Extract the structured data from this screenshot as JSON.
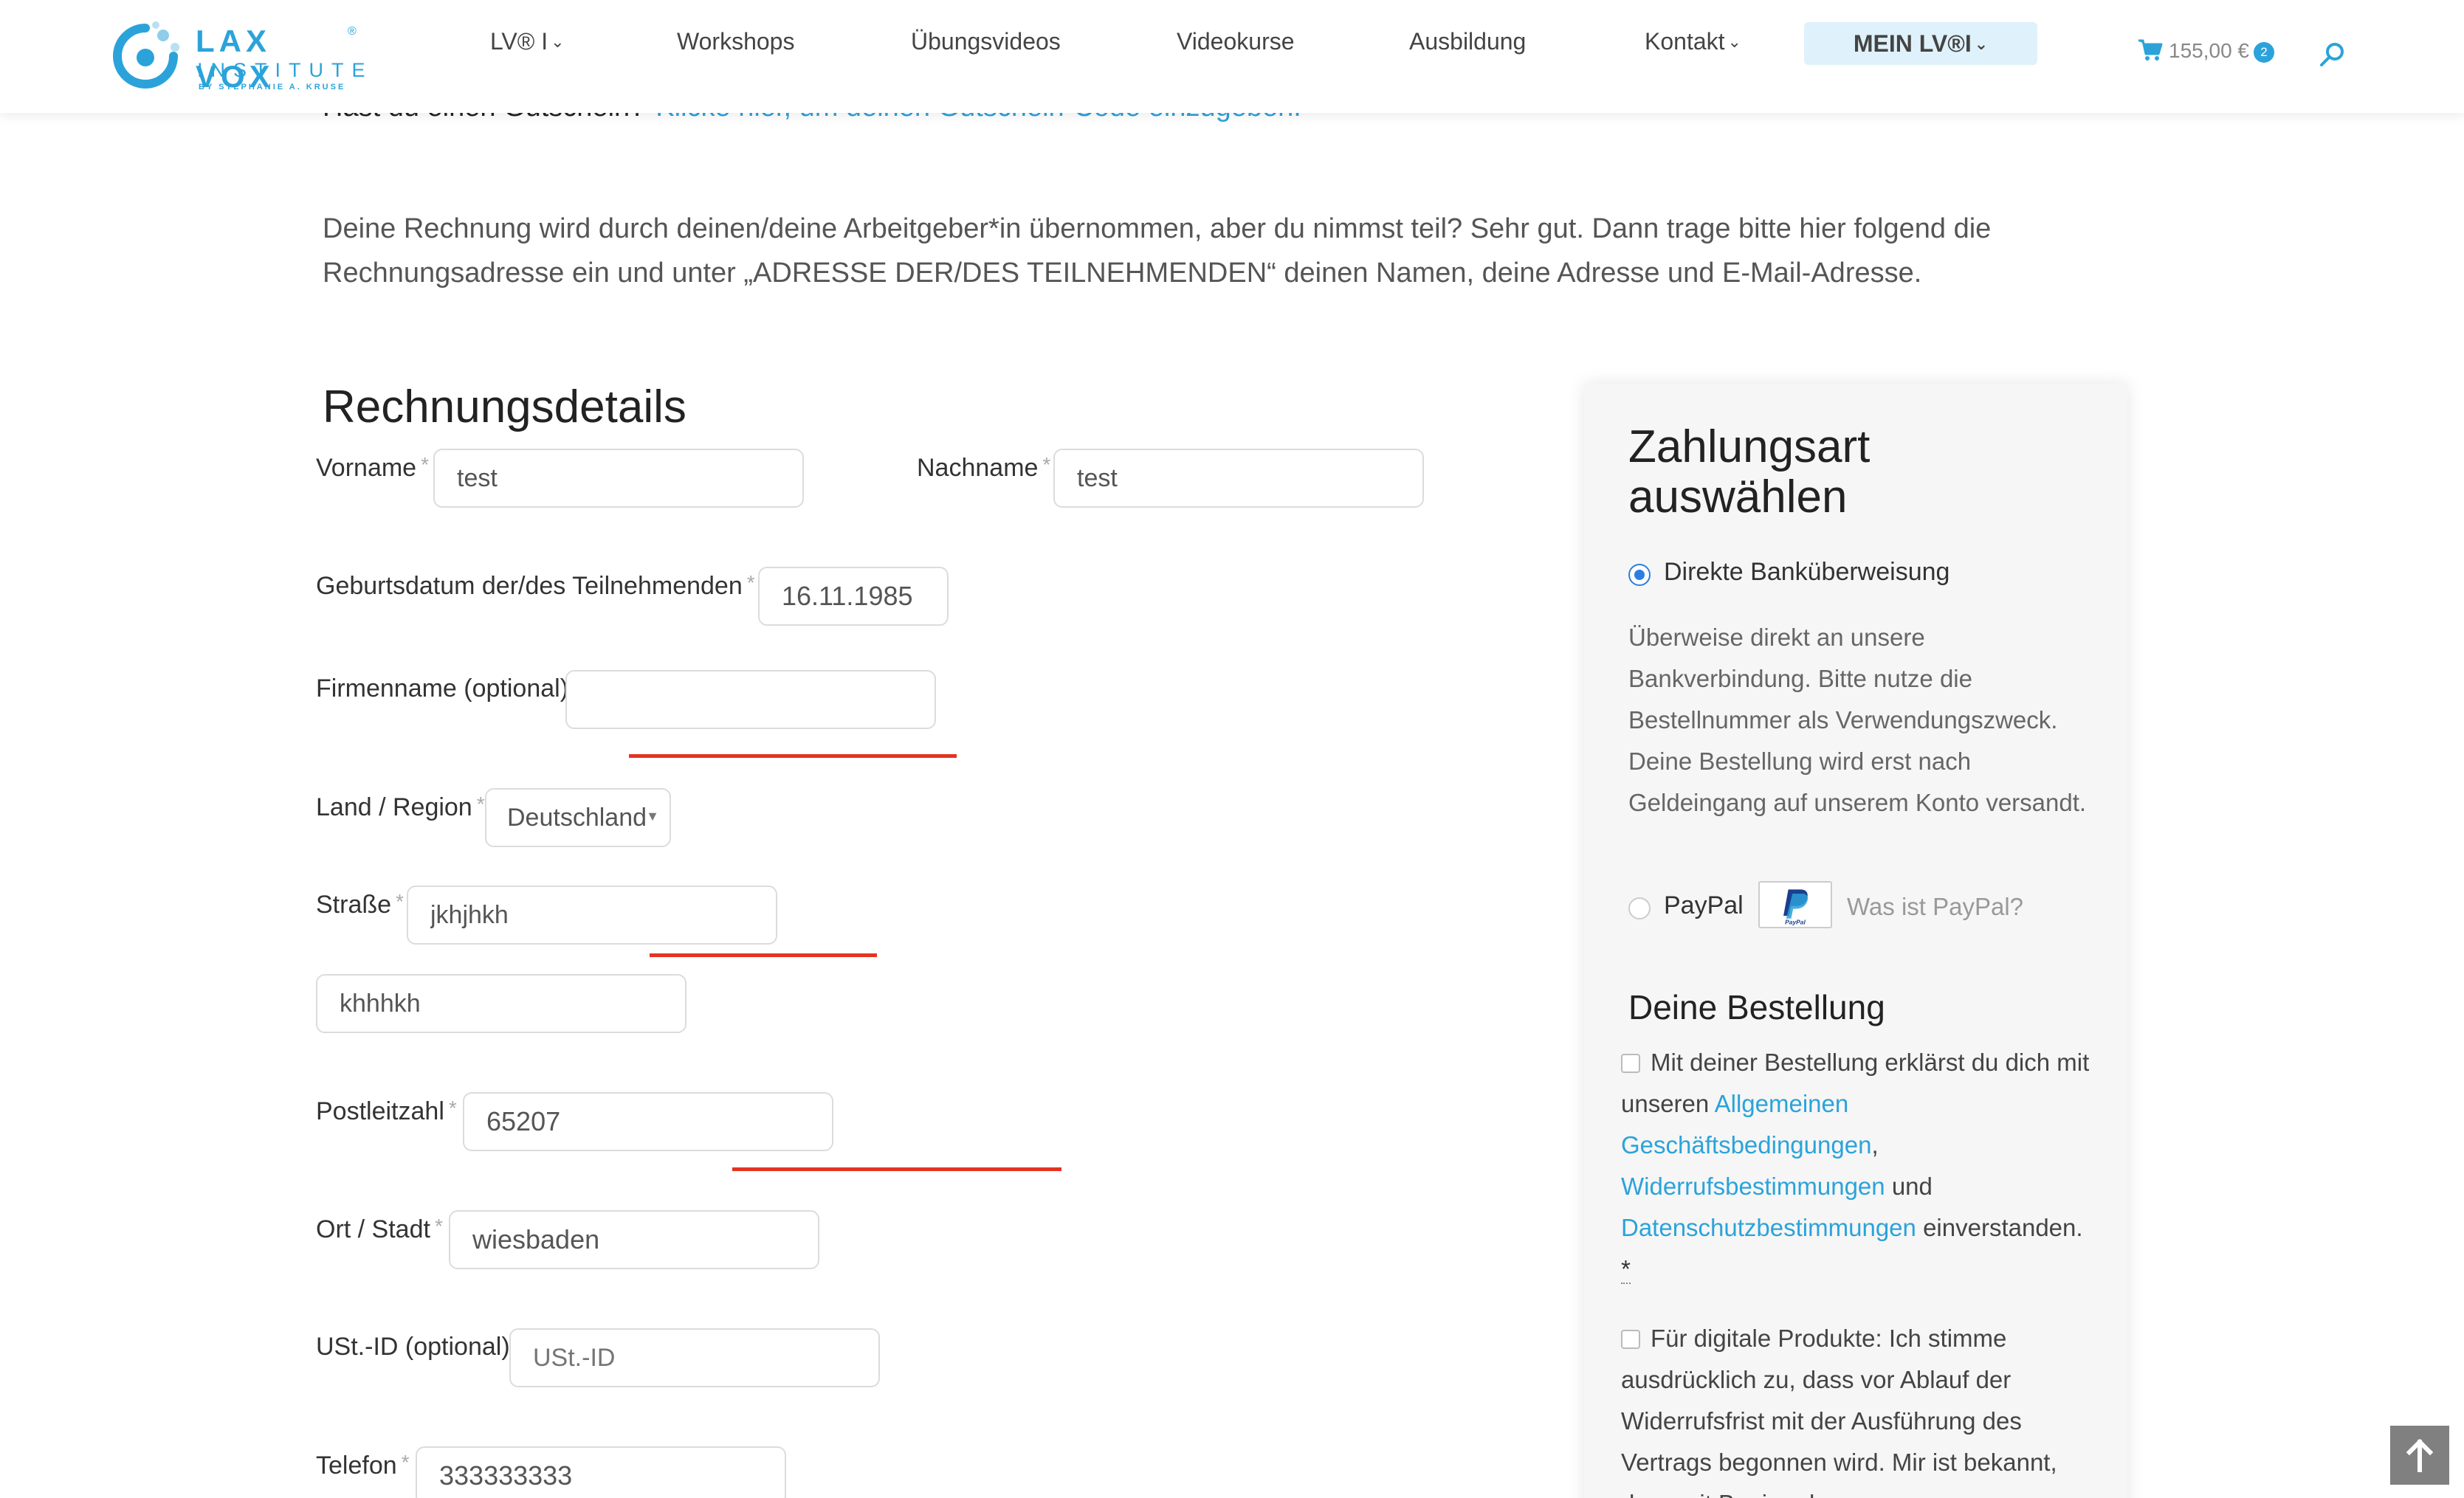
{
  "header": {
    "logo": {
      "line1": "LAX VOX",
      "line2": "INSTITUTE",
      "sub": "BY STEPHANIE A. KRUSE",
      "reg": "®"
    },
    "nav": [
      {
        "label": "LV® I",
        "dropdown": true
      },
      {
        "label": "Workshops",
        "dropdown": false
      },
      {
        "label": "Übungsvideos",
        "dropdown": false
      },
      {
        "label": "Videokurse",
        "dropdown": false
      },
      {
        "label": "Ausbildung",
        "dropdown": false
      },
      {
        "label": "Kontakt",
        "dropdown": true
      }
    ],
    "mein_label": "MEIN LV®I",
    "cart_total": "155,00 €",
    "cart_count": "2"
  },
  "coupon": {
    "question": "Hast du einen Gutschein?",
    "link": "Klicke hier, um deinen Gutschein-Code einzugeben."
  },
  "intro_text": "Deine Rechnung wird durch deinen/deine Arbeitgeber*in übernommen, aber du nimmst teil? Sehr gut. Dann trage bitte hier folgend die Rechnungsadresse ein und unter „ADRESSE DER/DES TEILNEHMENDEN“ deinen Namen, deine Adresse und E-Mail-Adresse.",
  "billing": {
    "title": "Rechnungsdetails",
    "required_marker": "*",
    "vorname": {
      "label": "Vorname",
      "value": "test"
    },
    "nachname": {
      "label": "Nachname",
      "value": "test"
    },
    "geburtsdatum": {
      "label": "Geburtsdatum der/des Teilnehmenden",
      "value": "16.11.1985"
    },
    "firma": {
      "label": "Firmenname (optional)",
      "value": ""
    },
    "land": {
      "label": "Land / Region",
      "value": "Deutschland"
    },
    "strasse": {
      "label": "Straße",
      "value": "jkhjhkh",
      "value2": "khhhkh"
    },
    "plz": {
      "label": "Postleitzahl",
      "value": "65207"
    },
    "ort": {
      "label": "Ort / Stadt",
      "value": "wiesbaden"
    },
    "ustid": {
      "label": "USt.-ID (optional)",
      "placeholder": "USt.-ID"
    },
    "telefon": {
      "label": "Telefon",
      "value": "333333333"
    }
  },
  "payment": {
    "title": "Zahlungsart auswählen",
    "bank_label": "Direkte Banküberweisung",
    "bank_desc": "Überweise direkt an unsere Bankverbindung. Bitte nutze die Bestellnummer als Verwendungszweck. Deine Bestellung wird erst nach Geldeingang auf unserem Konto versandt.",
    "paypal_label": "PayPal",
    "paypal_logo_text": "PayPal",
    "paypal_what": "Was ist PayPal?"
  },
  "order": {
    "title": "Deine Bestellung",
    "terms_prefix": "Mit deiner Bestellung erklärst du dich mit unseren",
    "terms_link1": "Allgemeinen Geschäftsbedingungen",
    "terms_sep": ",",
    "terms_link2": "Widerrufsbestimmungen",
    "terms_and": "und",
    "terms_link3": "Datenschutzbestimmungen",
    "terms_suffix": "einverstanden.",
    "terms_req": "*",
    "digital_text": "Für digitale Produkte: Ich stimme ausdrücklich zu, dass vor Ablauf der Widerrufsfrist mit der Ausführung des Vertrags begonnen wird. Mir ist bekannt, dass mit Beginn der"
  },
  "colors": {
    "accent": "#2ba3da",
    "radio": "#2a7fe0",
    "error_line": "#e53322",
    "panel_bg": "#f6f6f6"
  }
}
